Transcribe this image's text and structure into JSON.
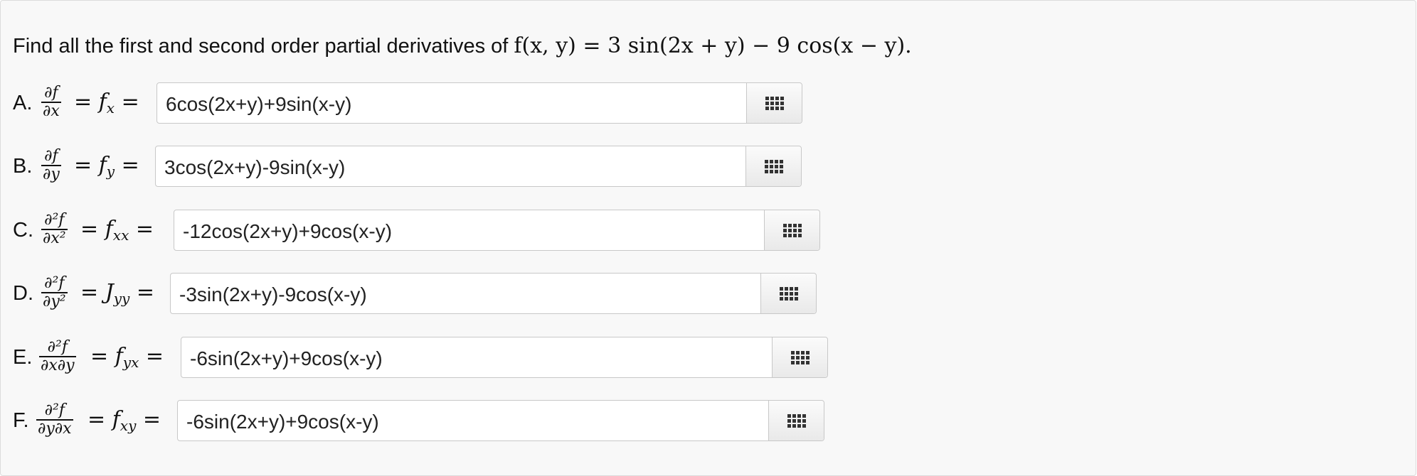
{
  "question": {
    "prefix": "Find all the first and second order partial derivatives of",
    "function": "f(x, y) = 3 sin(2x + y) − 9 cos(x − y)."
  },
  "parts": [
    {
      "letter": "A.",
      "num": "∂f",
      "den": "∂x",
      "lhs": "=",
      "fn": "f",
      "sub": "x",
      "rhs": "=",
      "value": "6cos(2x+y)+9sin(x-y)",
      "button": "grid-icon"
    },
    {
      "letter": "B.",
      "num": "∂f",
      "den": "∂y",
      "lhs": "=",
      "fn": "f",
      "sub": "y",
      "rhs": "=",
      "value": "3cos(2x+y)-9sin(x-y)",
      "button": "grid-icon"
    },
    {
      "letter": "C.",
      "num": "∂²f",
      "den": "∂x²",
      "lhs": "=",
      "fn": "f",
      "sub": "xx",
      "rhs": "=",
      "value": "-12cos(2x+y)+9cos(x-y)",
      "button": "grid-icon"
    },
    {
      "letter": "D.",
      "num": "∂²f",
      "den": "∂y²",
      "lhs": "=",
      "fn": "J",
      "sub": "yy",
      "rhs": "=",
      "value": "-3sin(2x+y)-9cos(x-y)",
      "button": "grid-icon"
    },
    {
      "letter": "E.",
      "num": "∂²f",
      "den": "∂x∂y",
      "lhs": "=",
      "fn": "f",
      "sub": "yx",
      "rhs": "=",
      "value": "-6sin(2x+y)+9cos(x-y)",
      "button": "grid-icon"
    },
    {
      "letter": "F.",
      "num": "∂²f",
      "den": "∂y∂x",
      "lhs": "=",
      "fn": "f",
      "sub": "xy",
      "rhs": "=",
      "value": "-6sin(2x+y)+9cos(x-y)",
      "button": "grid-icon"
    }
  ]
}
